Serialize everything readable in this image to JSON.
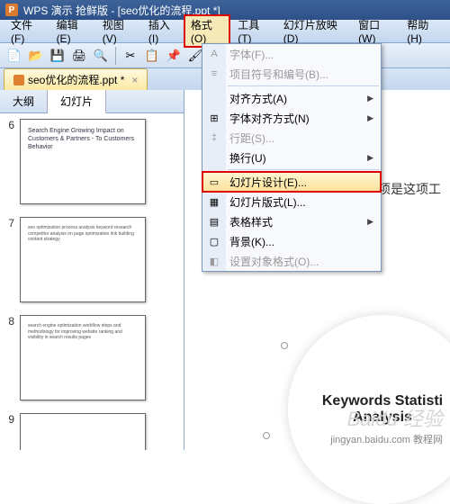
{
  "title": "WPS 演示 抢鲜版 - [seo优化的流程.ppt *]",
  "logo": "P",
  "menu": {
    "file": "文件(F)",
    "edit": "编辑(E)",
    "view": "视图(V)",
    "insert": "插入(I)",
    "format": "格式(O)",
    "tools": "工具(T)",
    "slideshow": "幻灯片放映(D)",
    "window": "窗口(W)",
    "help": "帮助(H)"
  },
  "tab": {
    "label": "seo优化的流程.ppt *",
    "close": "×"
  },
  "lefttabs": {
    "outline": "大纲",
    "slides": "幻灯片"
  },
  "thumbs": [
    {
      "n": "6",
      "cls": "s6",
      "t": "Search Engine Growing Impact on Customers & Partners - To Customers Behavior"
    },
    {
      "n": "7",
      "cls": "",
      "t": "seo optimization process analysis keyword research competitor analysis on page optimization link building content strategy"
    },
    {
      "n": "8",
      "cls": "",
      "t": "search engine optimization workflow steps and methodology for improving website ranking and visibility in search results pages"
    },
    {
      "n": "9",
      "cls": "",
      "t": ""
    }
  ],
  "dropdown": [
    {
      "ic": "A",
      "label": "字体(F)...",
      "dis": true
    },
    {
      "ic": "≡",
      "label": "项目符号和编号(B)...",
      "dis": true
    },
    {
      "type": "hr"
    },
    {
      "ic": "",
      "label": "对齐方式(A)",
      "arrow": "▶"
    },
    {
      "ic": "⊞",
      "label": "字体对齐方式(N)",
      "arrow": "▶"
    },
    {
      "ic": "‡",
      "label": "行距(S)...",
      "dis": true
    },
    {
      "ic": "",
      "label": "换行(U)",
      "arrow": "▶"
    },
    {
      "type": "hr"
    },
    {
      "ic": "▭",
      "label": "幻灯片设计(E)...",
      "hl": true
    },
    {
      "ic": "▦",
      "label": "幻灯片版式(L)...",
      "dim": true
    },
    {
      "ic": "▤",
      "label": "表格样式",
      "arrow": "▶"
    },
    {
      "ic": "▢",
      "label": "背景(K)...",
      "dim": true
    },
    {
      "ic": "◧",
      "label": "设置对象格式(O)...",
      "dis": true
    }
  ],
  "slide": {
    "text": "下几项是这项工",
    "circle1": "Keywords Statisti",
    "circle2": "Analysis"
  },
  "wm1": "Baidu 经验",
  "wm2": "jingyan.baidu.com 教程网"
}
